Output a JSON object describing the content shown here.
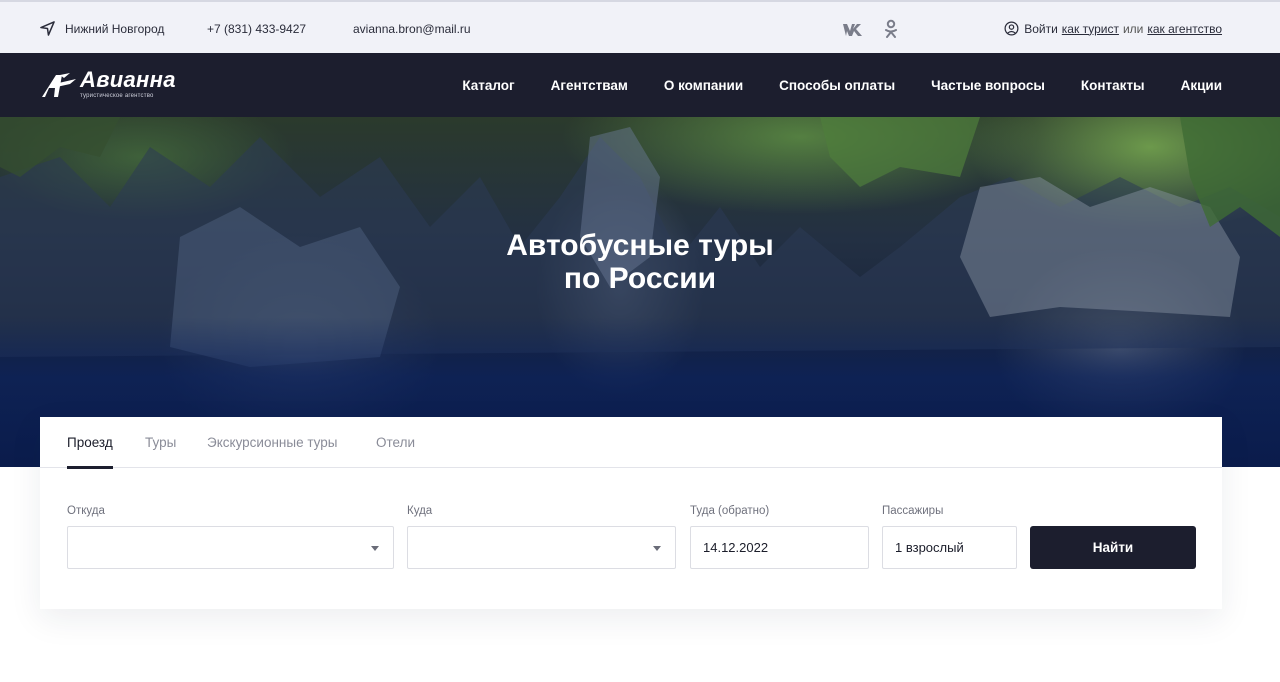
{
  "topbar": {
    "city": "Нижний Новгород",
    "phone": "+7 (831) 433-9427",
    "email": "avianna.bron@mail.ru",
    "social": [
      "vk-icon",
      "odnoklassniki-icon"
    ],
    "login_prefix": "Войти",
    "login_tourist": "как турист",
    "login_or": "или",
    "login_agency": "как агентство"
  },
  "logo": {
    "brand": "Авианна",
    "tagline": "туристическое агентство"
  },
  "nav": {
    "items": [
      "Каталог",
      "Агентствам",
      "О компании",
      "Способы оплаты",
      "Частые вопросы",
      "Контакты",
      "Акции"
    ]
  },
  "hero": {
    "title_line1": "Автобусные туры",
    "title_line2_prefix": "по",
    "title_line2_bold": "России"
  },
  "search": {
    "tabs": [
      "Проезд",
      "Туры",
      "Экскурсионные туры",
      "Отели"
    ],
    "active_tab": "Проезд",
    "from_label": "Откуда",
    "from_value": "",
    "to_label": "Куда",
    "to_value": "",
    "date_label": "Туда (обратно)",
    "date_value": "14.12.2022",
    "passengers_label": "Пассажиры",
    "passengers_value": "1 взрослый",
    "submit": "Найти"
  },
  "colors": {
    "navbar": "#1c1e2e",
    "topbar": "#f1f2f8",
    "button": "#1c1e2e"
  }
}
